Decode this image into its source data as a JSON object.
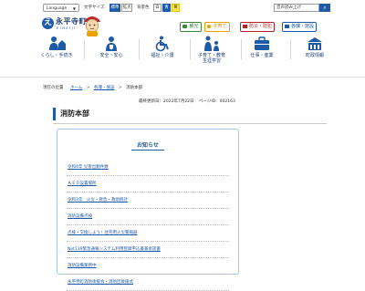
{
  "topbar": {
    "language_label": "Language",
    "font_size_label": "文字サイズ",
    "font_sizes": [
      "標準",
      "拡大"
    ],
    "color_label": "背景色",
    "colors": [
      "白",
      "青",
      "黄"
    ],
    "search_placeholder": "音声読み上げ"
  },
  "header": {
    "logo_name": "永平寺町",
    "logo_sub": "EIHEIJI",
    "quick_links": {
      "kanko": "観光",
      "kosodate": "子育て",
      "bousai": "防災・防犯",
      "shisetsu": "各課・施設"
    }
  },
  "nav": [
    {
      "label": "くらし・手続き",
      "icon": "person-house-icon"
    },
    {
      "label": "安全・安心",
      "icon": "shield-person-icon"
    },
    {
      "label": "福祉・介護",
      "icon": "wheelchair-icon"
    },
    {
      "label": "子育て・教育",
      "label2": "生涯学習",
      "icon": "family-icon"
    },
    {
      "label": "仕事・産業",
      "icon": "briefcase-icon"
    },
    {
      "label": "町政情報",
      "icon": "building-icon"
    }
  ],
  "breadcrumb": {
    "head": "現在の位置",
    "items": [
      "ホーム",
      "各課・施設"
    ],
    "current": "消防本部"
  },
  "dates": {
    "updated": "最終更新日：2022年7月22日",
    "page_id": "ページID：002163"
  },
  "page": {
    "title": "消防本部"
  },
  "osirase": {
    "title": "お知らせ",
    "items": [
      "令和4年 災害出動件数",
      "ＡＥＤ設置場所",
      "令和3年　火災・救急・救助統計",
      "消防設備点検",
      "点検・交換しよう！住宅用火災警報器",
      "Net119緊急通報システム利用登録申込書兼承諾書",
      "消防設備業務中",
      "永平寺町消防後援会・消防団後援式"
    ]
  }
}
